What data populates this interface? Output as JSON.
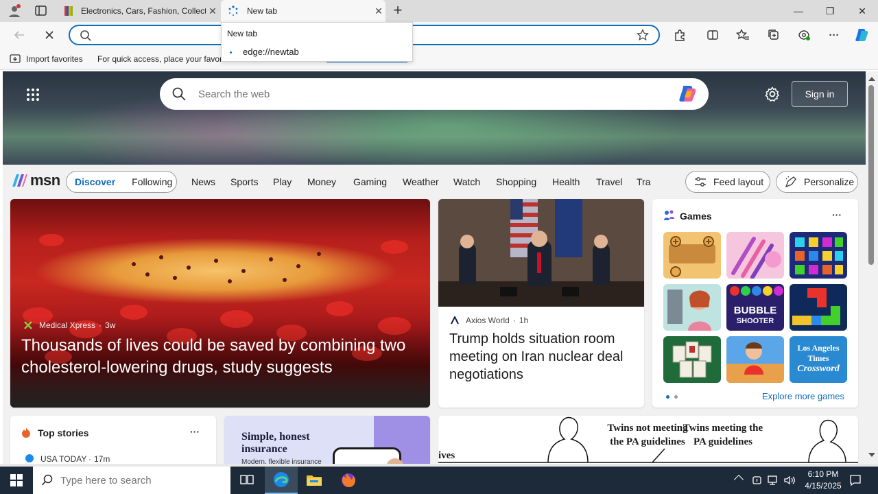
{
  "browser": {
    "tabs": [
      {
        "title": "Electronics, Cars, Fashion, Collectibles & More | eBay"
      },
      {
        "title": "New tab"
      }
    ],
    "new_tab_symbol": "+",
    "close_symbol": "✕",
    "window": {
      "minimize": "—",
      "restore": "❐",
      "close": "✕"
    },
    "address": {
      "value": "",
      "placeholder": ""
    },
    "favorites": {
      "import": "Import favorites",
      "hint": "For quick access, place your favorites here on the favorites bar."
    },
    "dropdown": {
      "title": "New tab",
      "url": "edge://newtab"
    }
  },
  "msn": {
    "search_placeholder": "Search the web",
    "sign_in": "Sign in",
    "logo": "msn",
    "tabs": [
      "Discover",
      "Following"
    ],
    "nav": [
      "News",
      "Sports",
      "Play",
      "Money",
      "Gaming",
      "Weather",
      "Watch",
      "Shopping",
      "Health",
      "Travel",
      "Tra"
    ],
    "feed_layout": "Feed layout",
    "personalize": "Personalize",
    "main_story": {
      "source": "Medical Xpress",
      "age": "3w",
      "headline": "Thousands of lives could be saved by combining two cholesterol-lowering drugs, study suggests"
    },
    "second_story": {
      "source": "Axios World",
      "age": "1h",
      "headline": "Trump holds situation room meeting on Iran nuclear deal negotiations"
    },
    "games": {
      "title": "Games",
      "more": "···",
      "explore": "Explore more games",
      "tile_texts": {
        "bubble1": "BUBBLE",
        "bubble2": "SHOOTER",
        "crossword1": "Los Angeles",
        "crossword2": "Times",
        "crossword3": "Crossword"
      }
    },
    "top_stories": {
      "title": "Top stories",
      "more": "···",
      "source": "USA TODAY",
      "age": "17m"
    },
    "ad": {
      "title": "Simple, honest insurance",
      "sub": "Modern, flexible insurance"
    },
    "cartoon": {
      "left_word": "ives",
      "caption1": "Twins not meeting the PA guidelines",
      "caption2": "Twins meeting the PA guidelines"
    }
  },
  "taskbar": {
    "search_placeholder": "Type here to search",
    "time": "6:10 PM",
    "date": "4/15/2025"
  }
}
